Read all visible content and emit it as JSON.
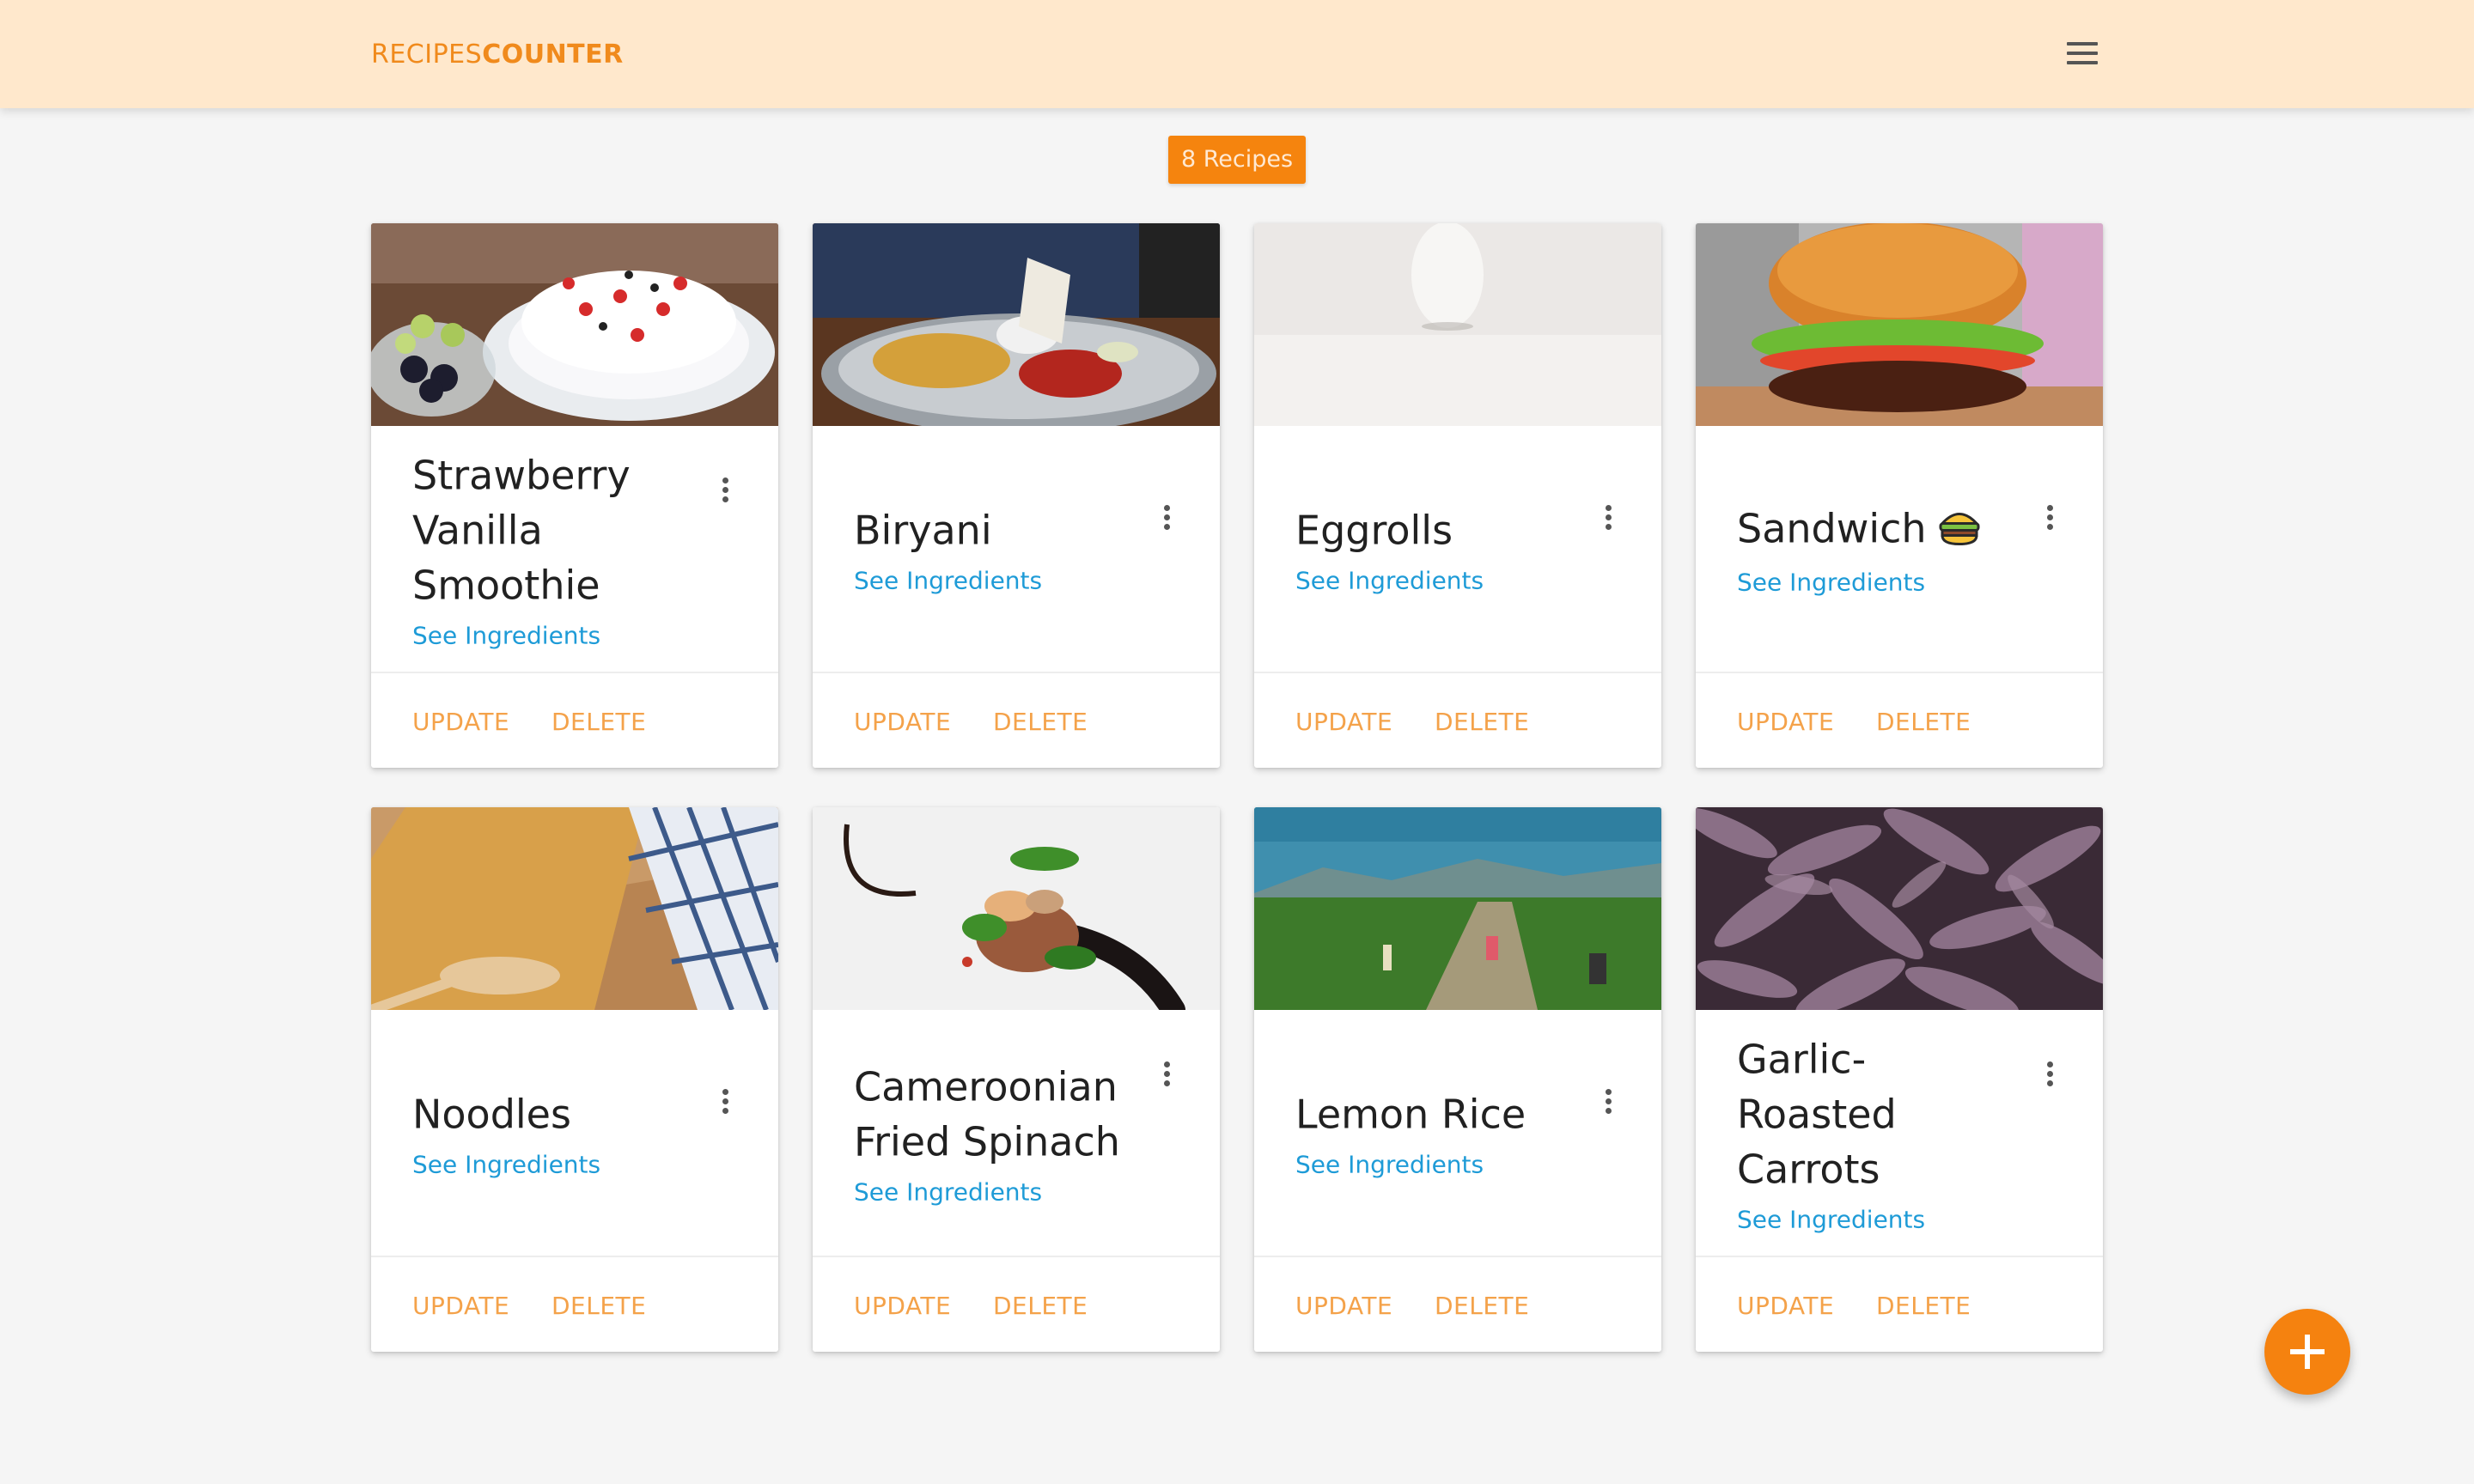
{
  "app": {
    "brand_light": "RECIPES",
    "brand_bold": "COUNTER",
    "accent": "#f5820f",
    "header_bg": "#ffe8cc"
  },
  "recipe_count_label": "8 Recipes",
  "recipes": [
    {
      "title": "Strawberry Vanilla Smoothie",
      "link": "See Ingredients",
      "update": "UPDATE",
      "delete": "DELETE"
    },
    {
      "title": "Biryani",
      "link": "See Ingredients",
      "update": "UPDATE",
      "delete": "DELETE"
    },
    {
      "title": "Eggrolls",
      "link": "See Ingredients",
      "update": "UPDATE",
      "delete": "DELETE"
    },
    {
      "title": "Sandwich",
      "link": "See Ingredients",
      "update": "UPDATE",
      "delete": "DELETE"
    },
    {
      "title": "Noodles",
      "link": "See Ingredients",
      "update": "UPDATE",
      "delete": "DELETE"
    },
    {
      "title": "Cameroonian Fried Spinach",
      "link": "See Ingredients",
      "update": "UPDATE",
      "delete": "DELETE"
    },
    {
      "title": "Lemon Rice",
      "link": "See Ingredients",
      "update": "UPDATE",
      "delete": "DELETE"
    },
    {
      "title": "Garlic-Roasted Carrots",
      "link": "See Ingredients",
      "update": "UPDATE",
      "delete": "DELETE"
    }
  ],
  "icons": {
    "menu": "hamburger-menu-icon",
    "more": "more-vert-icon",
    "sandwich": "burger-emoji-icon",
    "add": "plus-icon"
  }
}
